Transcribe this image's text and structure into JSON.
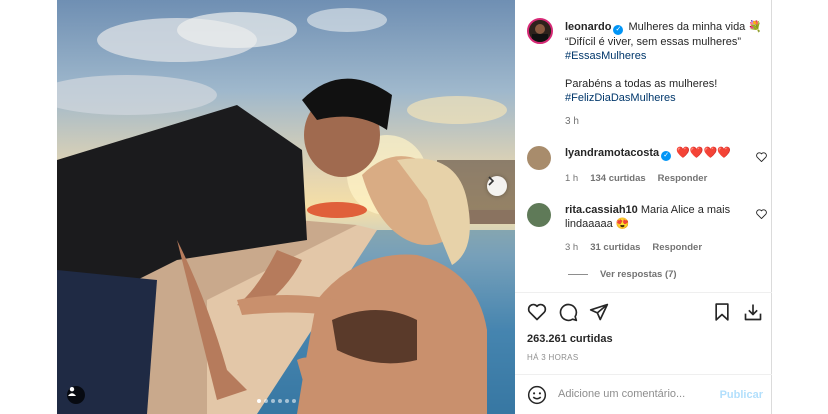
{
  "post": {
    "username": "leonardo",
    "caption_line1": "Mulheres da minha vida 💐",
    "caption_line2": "“Difícil é viver, sem essas mulheres”",
    "hashtag1": "#EssasMulheres",
    "caption_line3": "Parabéns a todas as mulheres!",
    "hashtag2": "#FelizDiaDasMulheres",
    "time": "3 h"
  },
  "comments": [
    {
      "username": "lyandramotacosta",
      "verified": true,
      "text": "❤️❤️❤️❤️",
      "time": "1 h",
      "likes": "134 curtidas",
      "reply": "Responder"
    },
    {
      "username": "rita.cassiah10",
      "verified": false,
      "text": "Maria Alice a mais lindaaaaa 😍",
      "time": "3 h",
      "likes": "31 curtidas",
      "reply": "Responder"
    }
  ],
  "view_replies": "Ver respostas (7)",
  "likes_count": "263.261 curtidas",
  "posted_ago": "HÁ 3 HORAS",
  "add_comment": {
    "placeholder": "Adicione um comentário...",
    "publish": "Publicar"
  },
  "carousel": {
    "total": 6,
    "current": 1
  },
  "icons": [
    "heart-icon",
    "comment-icon",
    "share-icon",
    "bookmark-icon",
    "download-icon",
    "emoji-icon",
    "chevron-right-icon",
    "user-tag-icon",
    "verified-icon"
  ],
  "colors": {
    "link": "#00376b",
    "verified": "#0095f6",
    "publish_disabled": "#b2dffc",
    "muted": "#8e8e8e"
  }
}
